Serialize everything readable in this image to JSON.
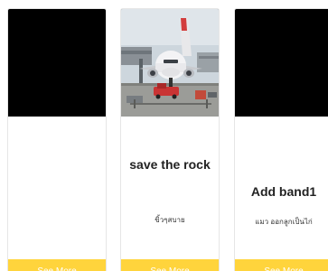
{
  "cards": [
    {
      "title": "",
      "description": "",
      "button_label": "See More",
      "image": "black-placeholder"
    },
    {
      "title": "save the rock",
      "description": "ขิ้วๆสบาย",
      "button_label": "See More",
      "image": "airplane-at-gate-photo"
    },
    {
      "title": "Add band1",
      "description": "แมว ออกลูกเป็นไก่",
      "button_label": "See More",
      "image": "black-placeholder"
    }
  ],
  "colors": {
    "button_background": "#ffd43c",
    "button_text": "#ffffff",
    "placeholder": "#000000"
  }
}
